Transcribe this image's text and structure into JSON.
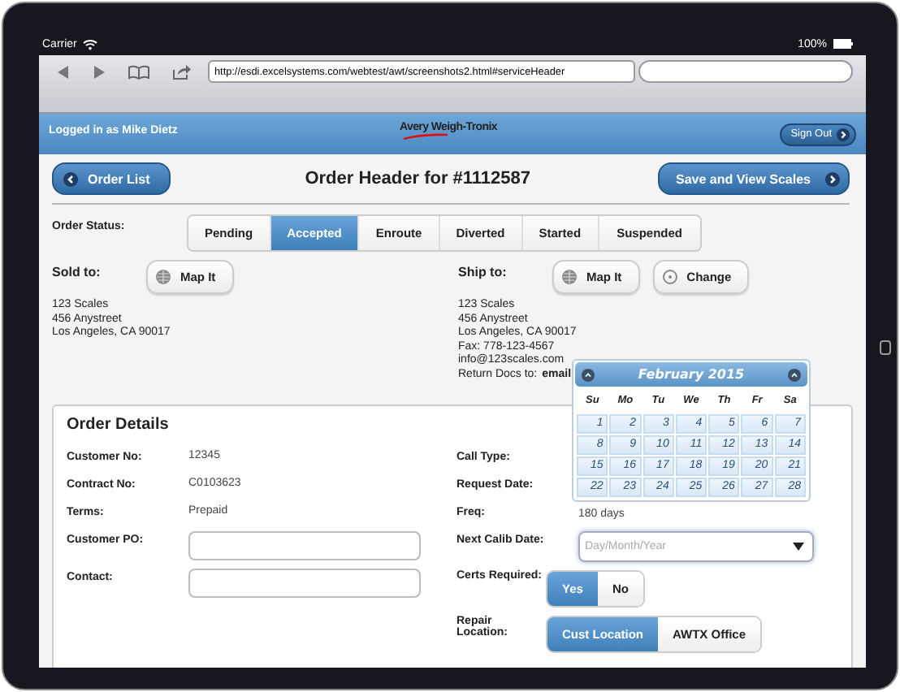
{
  "status_bar": {
    "carrier": "Carrier",
    "battery": "100%"
  },
  "browser": {
    "url": "http://esdi.excelsystems.com/webtest/awt/screenshots2.html#serviceHeader"
  },
  "header": {
    "user": "Logged in as Mike Dietz",
    "logo": "Avery Weigh-Tronix",
    "sign_out": "Sign Out"
  },
  "title_bar": {
    "back": "Order List",
    "title": "Order Header for #1112587",
    "save": "Save and View Scales"
  },
  "order_status": {
    "label": "Order Status:",
    "options": [
      {
        "label": "Pending",
        "selected": false
      },
      {
        "label": "Accepted",
        "selected": true
      },
      {
        "label": "Enroute",
        "selected": false
      },
      {
        "label": "Diverted",
        "selected": false
      },
      {
        "label": "Started",
        "selected": false
      },
      {
        "label": "Suspended",
        "selected": false
      }
    ]
  },
  "sold_to": {
    "label": "Sold to:",
    "map_button": "Map It",
    "lines": [
      "123 Scales",
      "456 Anystreet",
      "Los Angeles, CA 90017"
    ]
  },
  "ship_to": {
    "label": "Ship to:",
    "map_button": "Map It",
    "change_button": "Change",
    "lines": [
      "123 Scales",
      "456 Anystreet",
      "Los Angeles, CA 90017",
      "Fax: 778-123-4567",
      "info@123scales.com"
    ],
    "return_docs": {
      "label": "Return Docs to:",
      "value": "email"
    }
  },
  "order_details": {
    "title": "Order Details",
    "left_fields": [
      {
        "label": "Customer No:",
        "kind": "text",
        "value": "12345"
      },
      {
        "label": "Contract No:",
        "kind": "text",
        "value": "C0103623"
      },
      {
        "label": "Terms:",
        "kind": "text",
        "value": "Prepaid"
      },
      {
        "label": "Customer PO:",
        "kind": "input"
      },
      {
        "label": "Contact:",
        "kind": "input"
      }
    ],
    "right_fields": [
      {
        "label": "Call Type:",
        "kind": "text"
      },
      {
        "label": "Request Date:",
        "kind": "text"
      },
      {
        "label": "Freq:",
        "kind": "text",
        "value": "180 days"
      },
      {
        "label": "Next Calib Date:",
        "kind": "date",
        "placeholder": "Day/Month/Year"
      },
      {
        "label": "Certs Required:",
        "kind": "toggle",
        "options": [
          {
            "label": "Yes",
            "selected": true
          },
          {
            "label": "No",
            "selected": false
          }
        ]
      },
      {
        "label": "Repair Location:",
        "kind": "toggle",
        "options": [
          {
            "label": "Cust Location",
            "selected": true
          },
          {
            "label": "AWTX Office",
            "selected": false
          }
        ]
      }
    ]
  },
  "calendar": {
    "title": "February 2015",
    "weekdays": [
      "Su",
      "Mo",
      "Tu",
      "We",
      "Th",
      "Fr",
      "Sa"
    ],
    "weeks": [
      [
        "1",
        "2",
        "3",
        "4",
        "5",
        "6",
        "7"
      ],
      [
        "8",
        "9",
        "10",
        "11",
        "12",
        "13",
        "14"
      ],
      [
        "15",
        "16",
        "17",
        "18",
        "19",
        "20",
        "21"
      ],
      [
        "22",
        "23",
        "24",
        "25",
        "26",
        "27",
        "28"
      ]
    ]
  }
}
